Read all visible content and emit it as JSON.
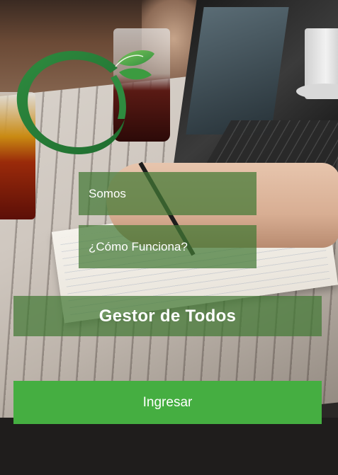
{
  "logo": {
    "icon": "leaf-ring-logo-icon",
    "colors": [
      "#2e8b3f",
      "#4fb04a",
      "#7cc35c"
    ]
  },
  "menu": [
    {
      "label": "Somos"
    },
    {
      "label": "¿Cómo Funciona?"
    }
  ],
  "title": "Gestor de Todos",
  "login_button": {
    "label": "Ingresar",
    "color": "#45ae41"
  },
  "overlay_color": "#437834"
}
